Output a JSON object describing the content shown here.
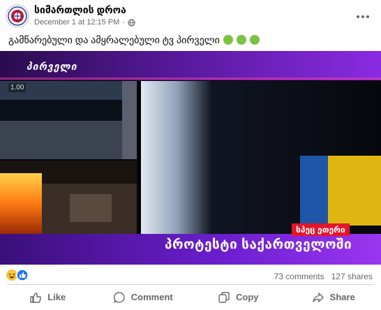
{
  "header": {
    "page_name": "სიმართლის დროა",
    "timestamp": "December 1 at 12:15 PM",
    "separator": "·",
    "audience_icon": "globe-icon",
    "more_icon": "ellipsis-icon"
  },
  "caption": {
    "text": "გამწარებული და ამყრალებული ტვ პირველი",
    "emoji": [
      "nauseated-face-emoji",
      "nauseated-face-emoji",
      "nauseated-face-emoji"
    ]
  },
  "video": {
    "channel_logo": "პირველი",
    "overlay_timestamp": "1.00",
    "banner_tag": "სპეც ეთერი",
    "banner_title": "პროტესტი საქართველოში",
    "colors": {
      "banner_purple": "#7a1fd6",
      "banner_red": "#e3162b",
      "logo_pink": "#ff3ea5"
    }
  },
  "stats": {
    "reaction_icons": [
      "haha-reaction-icon",
      "like-reaction-icon"
    ],
    "comments": "73 comments",
    "shares": "127 shares"
  },
  "actions": {
    "like": "Like",
    "comment": "Comment",
    "copy": "Copy",
    "share": "Share"
  }
}
